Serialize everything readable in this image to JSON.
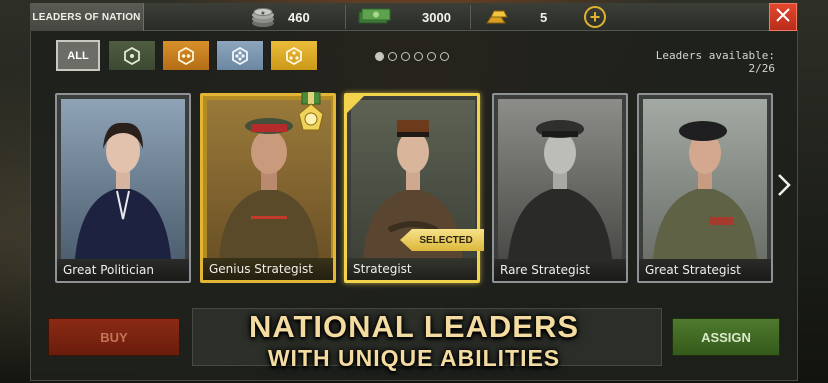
{
  "header": {
    "title": "LEADERS OF NATION",
    "resources": [
      {
        "name": "tokens",
        "icon": "token-stack-icon",
        "value": "460"
      },
      {
        "name": "cash",
        "icon": "banknotes-icon",
        "value": "3000"
      },
      {
        "name": "gold",
        "icon": "gold-bars-icon",
        "value": "5"
      }
    ]
  },
  "filters": [
    {
      "label": "ALL",
      "icon": null,
      "active": true
    },
    {
      "label": "",
      "icon": "hex-one-dot-icon",
      "active": false
    },
    {
      "label": "",
      "icon": "hex-two-dots-icon",
      "active": false
    },
    {
      "label": "",
      "icon": "hex-four-dots-icon",
      "active": false
    },
    {
      "label": "",
      "icon": "hex-three-dots-icon",
      "active": false
    }
  ],
  "pagination": {
    "pages": 6,
    "current": 1
  },
  "leaders_available": "Leaders available: 2/26",
  "cards": [
    {
      "label": "Great Politician",
      "frame": "silver"
    },
    {
      "label": "Genius Strategist",
      "frame": "gold"
    },
    {
      "label": "Strategist",
      "frame": "selected"
    },
    {
      "label": "Rare Strategist",
      "frame": "silver"
    },
    {
      "label": "Great Strategist",
      "frame": "silver"
    }
  ],
  "selected_badge": "SELECTED",
  "buttons": {
    "buy": "BUY",
    "assign": "ASSIGN"
  },
  "promo": {
    "line1": "NATIONAL LEADERS",
    "line2": "WITH UNIQUE ABILITIES"
  },
  "colors": {
    "gold_accent": "#e3b535",
    "close_red": "#d33a22",
    "assign_green": "#4e7a2e",
    "buy_red": "#8b2a15"
  }
}
